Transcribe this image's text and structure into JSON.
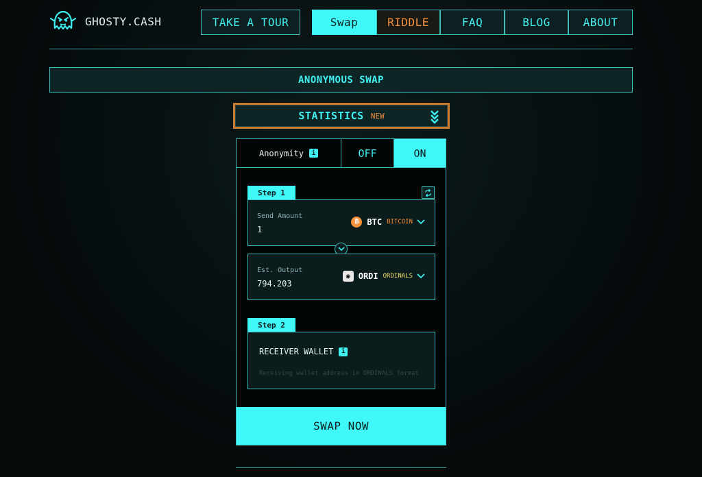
{
  "brand": {
    "name": "GHOSTY.CASH",
    "icon": "ghost-icon"
  },
  "nav": {
    "tour": "TAKE A TOUR",
    "swap": "Swap",
    "riddle": "RIDDLE",
    "faq": "FAQ",
    "blog": "BLOG",
    "about": "ABOUT"
  },
  "banner": {
    "title": "ANONYMOUS SWAP"
  },
  "statistics": {
    "label": "STATISTICS",
    "badge": "NEW",
    "icon": "double-chevron-down-icon"
  },
  "anonymity": {
    "label": "Anonymity",
    "info": "i",
    "off": "OFF",
    "on": "ON",
    "state": "ON"
  },
  "step1": {
    "tab": "Step 1",
    "send": {
      "label": "Send Amount",
      "value": "1",
      "coin_symbol": "BTC",
      "coin_name": "BITCOIN",
      "coin_glyph": "₿"
    },
    "output": {
      "label": "Est. Output",
      "value": "794.203",
      "coin_symbol": "ORDI",
      "coin_name": "ORDINALS",
      "coin_glyph": "◉"
    }
  },
  "step2": {
    "tab": "Step 2",
    "receiver_label": "RECEIVER WALLET",
    "info": "i",
    "placeholder": "Receiving wallet address in ORDINALS format"
  },
  "action": {
    "swap_now": "SWAP NOW"
  },
  "colors": {
    "accent": "#40f8f8",
    "orange": "#f5913d",
    "border": "#3fbdbd",
    "background": "#050a0b"
  }
}
